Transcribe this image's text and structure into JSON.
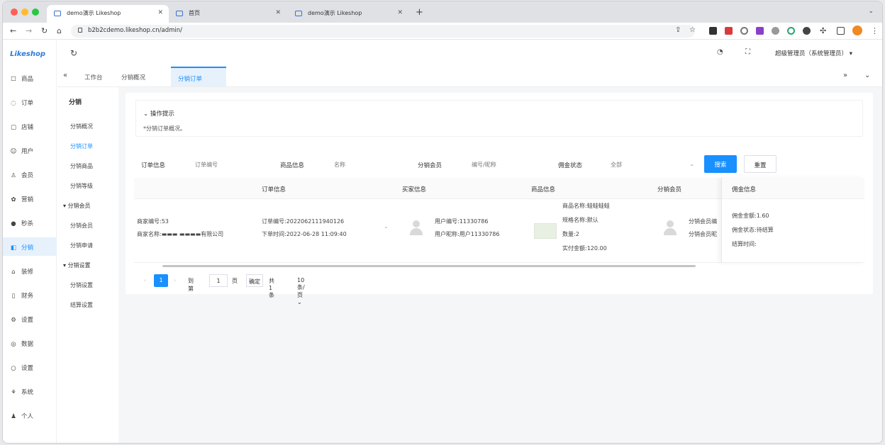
{
  "browser": {
    "tabs": [
      {
        "title": "demo演示 Likeshop",
        "active": true
      },
      {
        "title": "首页",
        "active": false
      },
      {
        "title": "demo演示 Likeshop",
        "active": false
      }
    ],
    "url": "b2b2cdemo.likeshop.cn/admin/"
  },
  "app": {
    "logo": "Likeshop",
    "user": "超级管理员（系统管理员）",
    "sidebar": [
      {
        "icon": "goods-icon",
        "glyph": "☐",
        "label": "商品"
      },
      {
        "icon": "order-icon",
        "glyph": "◌",
        "label": "订单"
      },
      {
        "icon": "store-icon",
        "glyph": "▢",
        "label": "店铺"
      },
      {
        "icon": "user-icon",
        "glyph": "☺",
        "label": "用户"
      },
      {
        "icon": "member-icon",
        "glyph": "♙",
        "label": "会员"
      },
      {
        "icon": "marketing-icon",
        "glyph": "✿",
        "label": "营销"
      },
      {
        "icon": "seckill-icon",
        "glyph": "●",
        "label": "秒杀"
      },
      {
        "icon": "distribution-icon",
        "glyph": "◧",
        "label": "分销"
      },
      {
        "icon": "decorate-icon",
        "glyph": "⌂",
        "label": "装修"
      },
      {
        "icon": "finance-icon",
        "glyph": "▯",
        "label": "财务"
      },
      {
        "icon": "settings-icon",
        "glyph": "⚙",
        "label": "设置"
      },
      {
        "icon": "data-icon",
        "glyph": "◎",
        "label": "数据"
      },
      {
        "icon": "system-icon",
        "glyph": "○",
        "label": "设置"
      },
      {
        "icon": "permission-icon",
        "glyph": "⚘",
        "label": "系统"
      },
      {
        "icon": "profile-icon",
        "glyph": "♟",
        "label": "个人"
      }
    ],
    "submenu": {
      "title": "分销",
      "items": [
        {
          "label": "分销概况",
          "type": "item"
        },
        {
          "label": "分销订单",
          "type": "item",
          "active": true
        },
        {
          "label": "分销商品",
          "type": "item"
        },
        {
          "label": "分销等级",
          "type": "item"
        },
        {
          "label": "分销会员",
          "type": "group"
        },
        {
          "label": "分销会员",
          "type": "item"
        },
        {
          "label": "分销申请",
          "type": "item"
        },
        {
          "label": "分销设置",
          "type": "group"
        },
        {
          "label": "分销设置",
          "type": "item"
        },
        {
          "label": "结算设置",
          "type": "item"
        }
      ]
    },
    "tags": [
      {
        "label": "工作台"
      },
      {
        "label": "分销概况"
      },
      {
        "label": "分销订单",
        "active": true
      }
    ]
  },
  "panel": {
    "tip_title": "操作提示",
    "tip_body": "*分销订单概况。",
    "filters": [
      {
        "label": "订单信息",
        "value": "订单编号"
      },
      {
        "label": "商品信息",
        "value": "名称"
      },
      {
        "label": "分销会员",
        "value": "编号/昵称"
      },
      {
        "label": "佣金状态",
        "value": "全部"
      }
    ],
    "search_label": "搜索",
    "reset_label": "重置",
    "columns": [
      "订单信息",
      "买家信息",
      "商品信息",
      "分销会员",
      "佣金信息"
    ],
    "row": {
      "store_id": "商家编号:53",
      "store_name": "商家名称:▬▬▬ ▬▬▬▬有限公司",
      "order_no": "订单编号:2022062111940126",
      "order_time": "下单时间:2022-06-28 11:09:40",
      "buyer_no": "用户编号:11330786",
      "buyer_name": "用户昵称:用户11330786",
      "goods_name": "商品名称:蛙蛙蛙蛙",
      "goods_spec": "规格名称:默认",
      "goods_qty": "数量:2",
      "goods_paid": "实付金额:120.00",
      "dist_line1": "分销会员编",
      "dist_line2": "分销会员昵",
      "commission_amount": "佣金金额:1.60",
      "commission_status": "佣金状态:待结算",
      "commission_time": "结算时间:"
    },
    "pager": {
      "current": "1",
      "goto_prefix": "到第",
      "goto_page": "1",
      "goto_suffix": "页",
      "confirm": "确定",
      "total": "共1条",
      "page_size": "10条/页"
    }
  },
  "colors": {
    "accent": "#1890ff",
    "sidebar_active_bg": "#e6f1fb"
  }
}
